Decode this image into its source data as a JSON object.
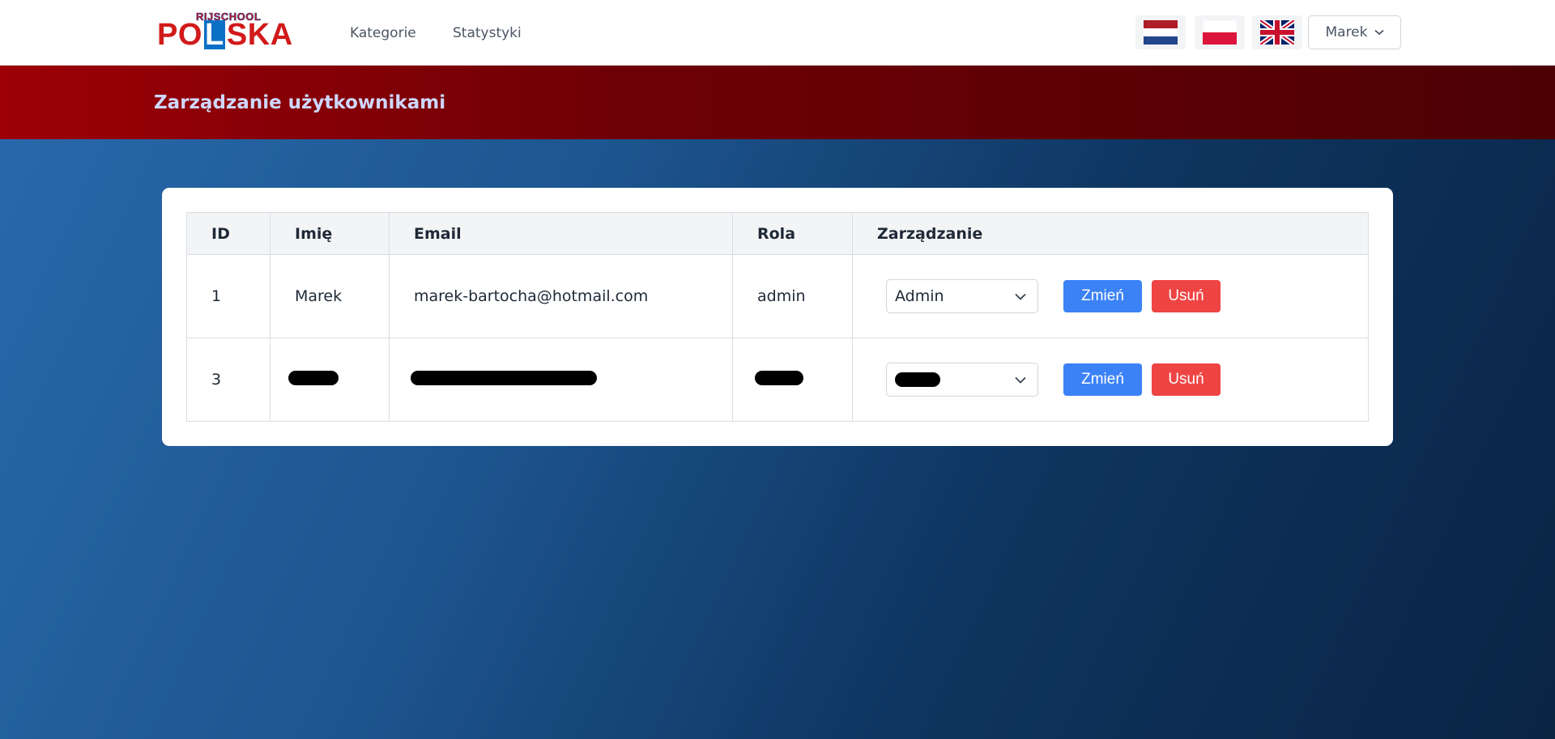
{
  "nav": {
    "logo_small": "RIJSCHOOL",
    "logo_p1": "PO",
    "logo_l": "L",
    "logo_p2": "SKA",
    "links": [
      "Kategorie",
      "Statystyki"
    ],
    "flags": [
      "netherlands-flag-icon",
      "poland-flag-icon",
      "uk-flag-icon"
    ],
    "user_label": "Marek"
  },
  "header": {
    "title": "Zarządzanie użytkownikami"
  },
  "table": {
    "columns": [
      "ID",
      "Imię",
      "Email",
      "Rola",
      "Zarządzanie"
    ],
    "rows": [
      {
        "id": "1",
        "name": "Marek",
        "email": "marek-bartocha@hotmail.com",
        "role": "admin",
        "select_value": "Admin",
        "change_label": "Zmień",
        "delete_label": "Usuń",
        "redacted": false
      },
      {
        "id": "3",
        "name": "",
        "email": "",
        "role": "",
        "select_value": "",
        "change_label": "Zmień",
        "delete_label": "Usuń",
        "redacted": true
      }
    ]
  },
  "colors": {
    "header_red": "#9c0006",
    "button_blue": "#3b82f6",
    "button_red": "#ef4444",
    "background_blue": "#1d5690"
  }
}
